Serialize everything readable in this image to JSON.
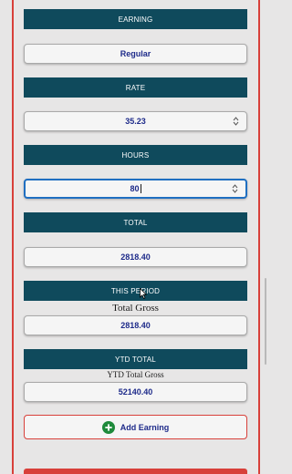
{
  "sections": {
    "earning": {
      "header": "EARNING",
      "value": "Regular"
    },
    "rate": {
      "header": "RATE",
      "value": "35.23"
    },
    "hours": {
      "header": "HOURS",
      "value": "80"
    },
    "total": {
      "header": "TOTAL",
      "value": "2818.40"
    },
    "this_period": {
      "header": "THIS PERIOD",
      "caption": "Total Gross",
      "value": "2818.40"
    },
    "ytd_total": {
      "header": "YTD TOTAL",
      "caption": "YTD Total Gross",
      "value": "52140.40"
    }
  },
  "add_button": {
    "label": "Add Earning",
    "icon": "plus-circle-icon"
  },
  "colors": {
    "header_bg": "#0f4a5c",
    "value_text": "#1e2b8a",
    "accent_red": "#d8403a",
    "add_icon": "#1e8a3b",
    "focus_border": "#1f6fc1"
  }
}
